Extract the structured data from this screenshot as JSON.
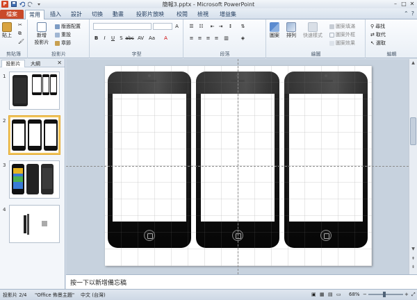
{
  "app": {
    "title": "簡報3.pptx - Microsoft PowerPoint",
    "brand_color": "#d24726",
    "file_tab_color": "#c94a2a"
  },
  "qat": {
    "app_icon": "P",
    "icons": [
      "save-icon",
      "undo-icon",
      "redo-icon",
      "customize-icon"
    ]
  },
  "window_controls": {
    "minimize": "–",
    "maximize": "□",
    "close": "✕"
  },
  "ribbon_tabs": [
    "檔案",
    "常用",
    "插入",
    "設計",
    "切換",
    "動畫",
    "投影片放映",
    "校閱",
    "檢視",
    "增益集"
  ],
  "ribbon_active_tab": "常用",
  "ribbon": {
    "clipboard": {
      "label": "剪貼簿",
      "paste": "貼上"
    },
    "slides": {
      "label": "投影片",
      "new_slide": "新增\n投影片",
      "layout": "版面配置",
      "reset": "重設",
      "section": "章節"
    },
    "font": {
      "label": "字型",
      "font_name": "",
      "font_size": ""
    },
    "paragraph": {
      "label": "段落"
    },
    "drawing": {
      "label": "繪圖",
      "shapes": "圖案",
      "arrange": "排列",
      "quick_styles": "快速樣式",
      "fill": "圖案填滿",
      "outline": "圖案外框",
      "effects": "圖案效果"
    },
    "editing": {
      "label": "編輯",
      "find": "尋找",
      "replace": "取代",
      "select": "選取"
    }
  },
  "left_pane": {
    "tabs": [
      "投影片",
      "大綱"
    ],
    "close": "✕",
    "thumbnails": [
      {
        "num": "1"
      },
      {
        "num": "2",
        "selected": true
      },
      {
        "num": "3"
      },
      {
        "num": "4"
      }
    ]
  },
  "notes": {
    "placeholder": "按一下以新增備忘稿"
  },
  "status": {
    "slide": "投影片 2/4",
    "theme": "\"Office 佈景主題\"",
    "language": "中文 (台灣)",
    "zoom": "68%",
    "zoom_level": 0.68
  }
}
